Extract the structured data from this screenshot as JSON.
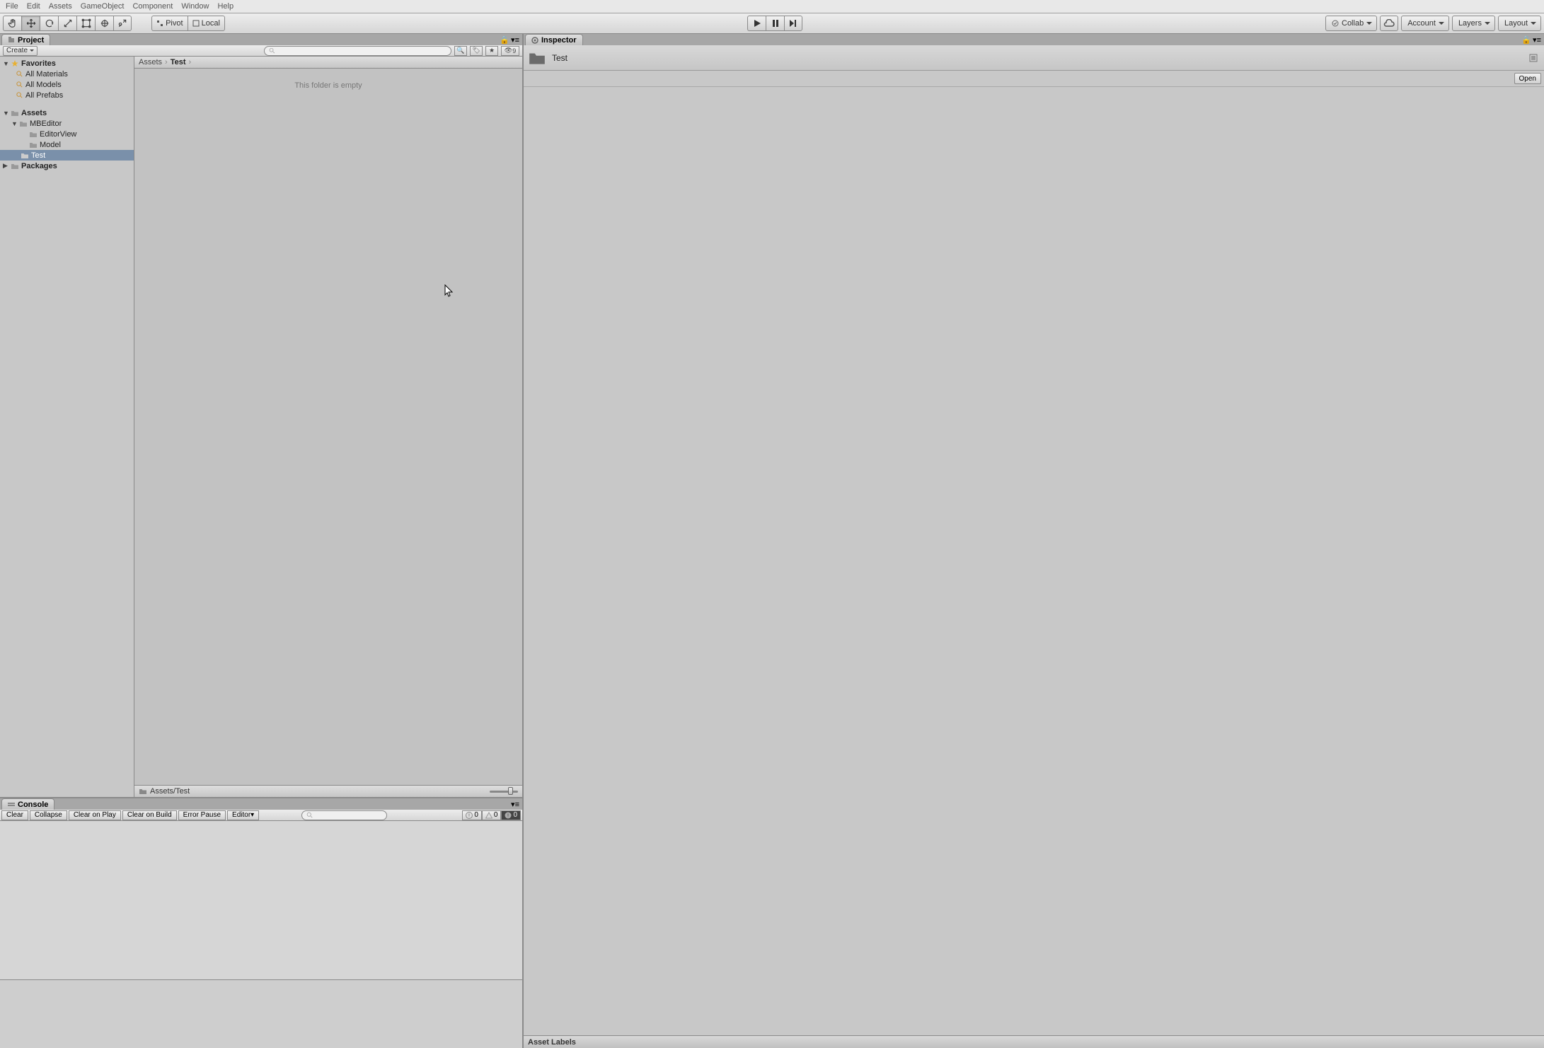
{
  "menubar": {
    "items": [
      "File",
      "Edit",
      "Assets",
      "GameObject",
      "Component",
      "Window",
      "Help"
    ]
  },
  "toolbar": {
    "pivot": "Pivot",
    "local": "Local",
    "collab": "Collab",
    "account": "Account",
    "layers": "Layers",
    "layout": "Layout"
  },
  "project": {
    "tab": "Project",
    "create": "Create",
    "search_placeholder": "",
    "hidden_count": "9",
    "tree": {
      "favorites": {
        "label": "Favorites",
        "items": [
          "All Materials",
          "All Models",
          "All Prefabs"
        ]
      },
      "assets": {
        "label": "Assets",
        "children": [
          {
            "label": "MBEditor",
            "children": [
              "EditorView",
              "Model"
            ]
          },
          {
            "label": "Test",
            "selected": true
          }
        ]
      },
      "packages": {
        "label": "Packages"
      }
    },
    "breadcrumb": [
      "Assets",
      "Test"
    ],
    "empty_msg": "This folder is empty",
    "footer_path": "Assets/Test"
  },
  "console": {
    "tab": "Console",
    "buttons": {
      "clear": "Clear",
      "collapse": "Collapse",
      "clear_play": "Clear on Play",
      "clear_build": "Clear on Build",
      "error_pause": "Error Pause",
      "editor": "Editor"
    },
    "counts": {
      "info": "0",
      "warn": "0",
      "error": "0"
    }
  },
  "inspector": {
    "tab": "Inspector",
    "title": "Test",
    "open": "Open",
    "asset_labels": "Asset Labels"
  }
}
